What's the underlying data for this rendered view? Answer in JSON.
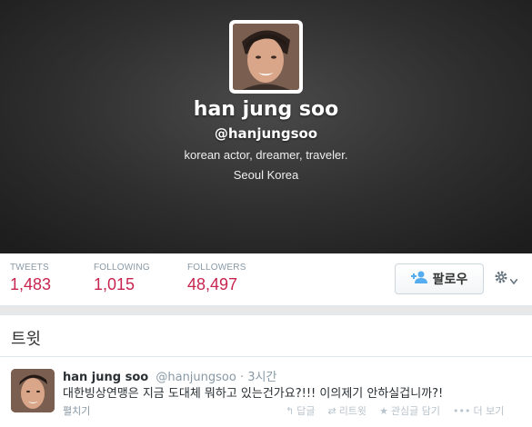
{
  "profile": {
    "name": "han jung soo",
    "handle": "@hanjungsoo",
    "bio": "korean actor, dreamer, traveler.",
    "location": "Seoul Korea"
  },
  "stats": {
    "tweets_label": "TWEETS",
    "tweets_value": "1,483",
    "following_label": "FOLLOWING",
    "following_value": "1,015",
    "followers_label": "FOLLOWERS",
    "followers_value": "48,497"
  },
  "actions": {
    "follow_label": "팔로우"
  },
  "tweets_section": {
    "title": "트윗"
  },
  "tweet": {
    "author_name": "han jung soo",
    "author_handle": "@hanjungsoo",
    "time": "· 3시간",
    "text": "대한빙상연맹은 지금 도대체 뭐하고 있는건가요?!!! 이의제기 안하실겁니까?!",
    "expand": "펼치기",
    "reply": "답글",
    "retweet": "리트윗",
    "favorite": "관심글 담기",
    "more": "더 보기"
  },
  "colors": {
    "stat_value": "#c7254e",
    "muted": "#8899a6"
  }
}
